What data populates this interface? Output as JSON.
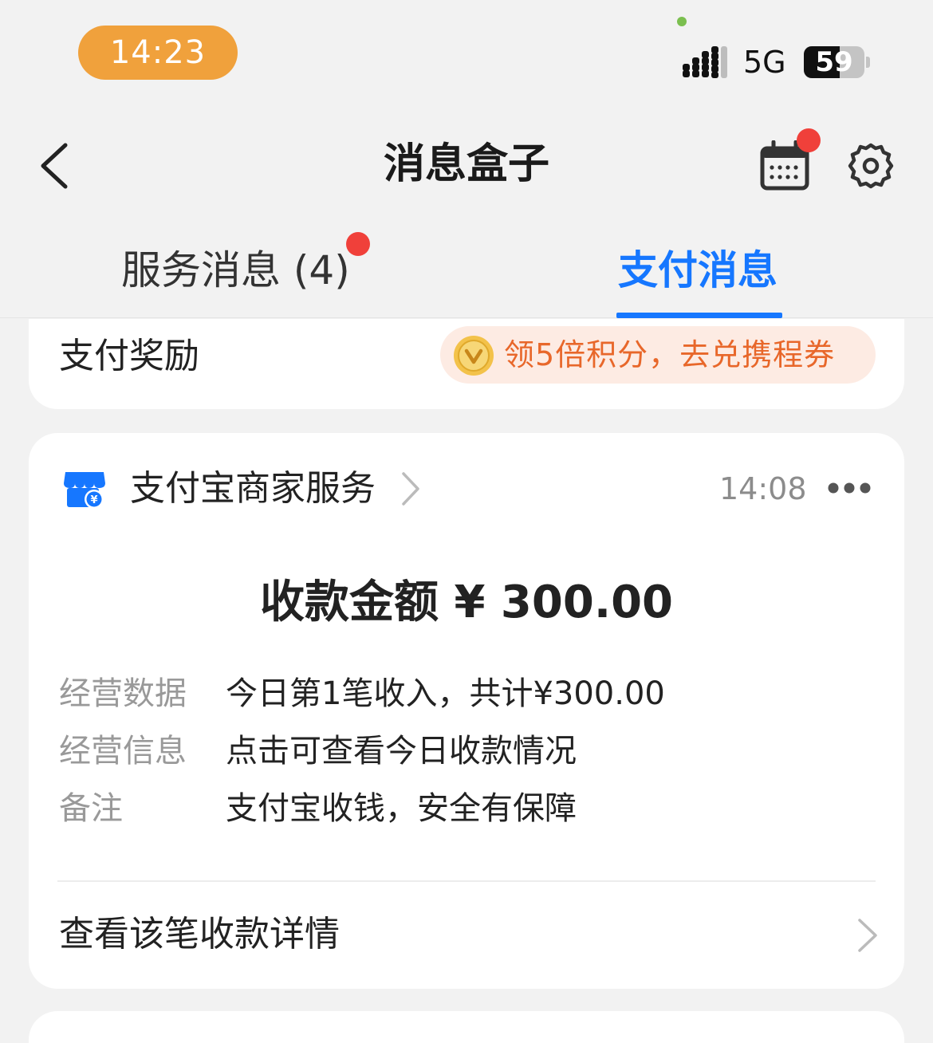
{
  "status_bar": {
    "time": "14:23",
    "network": "5G",
    "battery": "59",
    "battery_level": 0.59
  },
  "nav": {
    "title": "消息盒子"
  },
  "tabs": [
    {
      "label": "服务消息 (4)",
      "active": false,
      "has_badge": true
    },
    {
      "label": "支付消息",
      "active": true
    }
  ],
  "reward_card": {
    "label": "支付奖励",
    "promo": "领5倍积分，去兑携程券"
  },
  "message_card": {
    "merchant": "支付宝商家服务",
    "time": "14:08",
    "amount": "收款金额 ¥ 300.00",
    "rows": [
      {
        "label": "经营数据",
        "value": "今日第1笔收入，共计¥300.00"
      },
      {
        "label": "经营信息",
        "value": "点击可查看今日收款情况"
      },
      {
        "label": "备注",
        "value": "支付宝收钱，安全有保障"
      }
    ],
    "detail_link": "查看该笔收款详情"
  },
  "colors": {
    "accent": "#1677ff",
    "badge": "#f0403a",
    "time_pill": "#f0a13c",
    "promo_text": "#e8672a",
    "promo_bg": "#fdebe3"
  }
}
